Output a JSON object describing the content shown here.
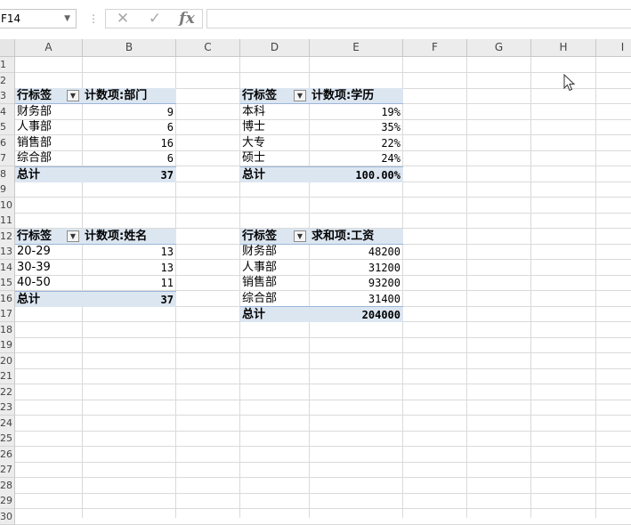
{
  "formula_bar": {
    "name_box": "F14",
    "cancel_icon": "✕",
    "enter_icon": "✓",
    "fx_label": "fx",
    "formula": ""
  },
  "columns": [
    "A",
    "B",
    "C",
    "D",
    "E",
    "F",
    "G",
    "H",
    "I"
  ],
  "rows": [
    "1",
    "2",
    "3",
    "4",
    "5",
    "6",
    "7",
    "8",
    "9",
    "10",
    "11",
    "12",
    "13",
    "14",
    "15",
    "16",
    "17",
    "18",
    "19",
    "20",
    "21",
    "22",
    "23",
    "24",
    "25",
    "26",
    "27",
    "28",
    "29",
    "30"
  ],
  "pivot_dept": {
    "row_label": "行标签",
    "value_label": "计数项:部门",
    "items": [
      {
        "label": "财务部",
        "value": "9"
      },
      {
        "label": "人事部",
        "value": "6"
      },
      {
        "label": "销售部",
        "value": "16"
      },
      {
        "label": "综合部",
        "value": "6"
      }
    ],
    "total_label": "总计",
    "total_value": "37"
  },
  "pivot_edu": {
    "row_label": "行标签",
    "value_label": "计数项:学历",
    "items": [
      {
        "label": "本科",
        "value": "19%"
      },
      {
        "label": "博士",
        "value": "35%"
      },
      {
        "label": "大专",
        "value": "22%"
      },
      {
        "label": "硕士",
        "value": "24%"
      }
    ],
    "total_label": "总计",
    "total_value": "100.00%"
  },
  "pivot_age": {
    "row_label": "行标签",
    "value_label": "计数项:姓名",
    "items": [
      {
        "label": "20-29",
        "value": "13"
      },
      {
        "label": "30-39",
        "value": "13"
      },
      {
        "label": "40-50",
        "value": "11"
      }
    ],
    "total_label": "总计",
    "total_value": "37"
  },
  "pivot_salary": {
    "row_label": "行标签",
    "value_label": "求和项:工资",
    "items": [
      {
        "label": "财务部",
        "value": "48200"
      },
      {
        "label": "人事部",
        "value": "31200"
      },
      {
        "label": "销售部",
        "value": "93200"
      },
      {
        "label": "综合部",
        "value": "31400"
      }
    ],
    "total_label": "总计",
    "total_value": "204000"
  },
  "dropdown_icon": "▼",
  "colors": {
    "pivot_header_fill": "#dce6f1",
    "pivot_border": "#9bb7d8",
    "header_bg": "#ececec",
    "gridline": "#dadada"
  }
}
